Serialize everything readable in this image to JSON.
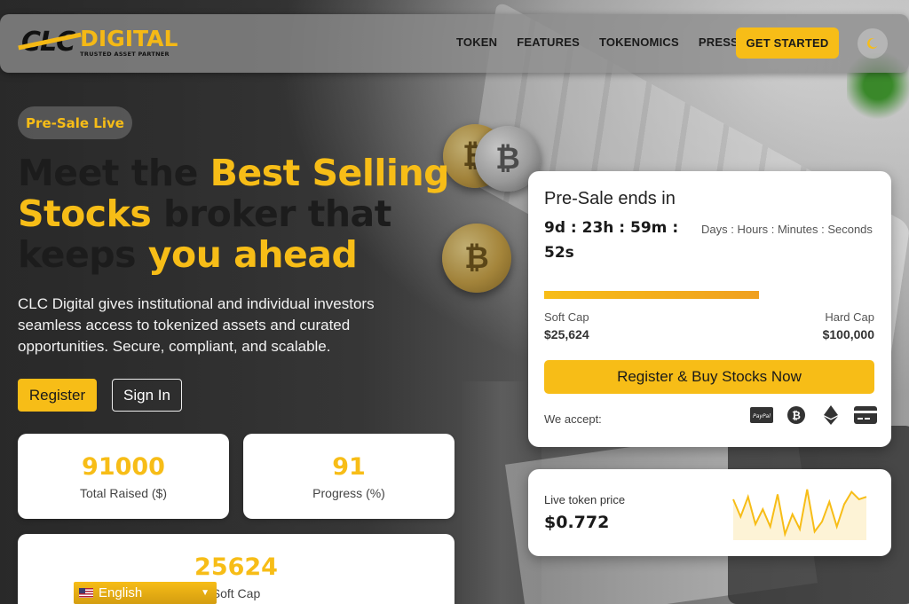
{
  "header": {
    "logo_mark": "CLC",
    "logo_title": "DIGITAL",
    "logo_subtitle": "TRUSTED ASSET PARTNER",
    "nav": [
      {
        "label": "TOKEN"
      },
      {
        "label": "FEATURES"
      },
      {
        "label": "TOKENOMICS"
      },
      {
        "label": "PRESS"
      }
    ],
    "cta_label": "GET STARTED",
    "theme_icon": "moon-icon"
  },
  "hero": {
    "badge": "Pre-Sale Live",
    "headline": {
      "p1": "Meet the ",
      "h1": "Best Selling Stocks",
      "p2": " broker that keeps ",
      "h2": "you ahead"
    },
    "lead": "CLC Digital gives institutional and individual investors seamless access to tokenized assets and curated opportunities. Secure, compliant, and scalable.",
    "register_label": "Register",
    "signin_label": "Sign In"
  },
  "stats": [
    {
      "value": "91000",
      "label": "Total Raised ($)"
    },
    {
      "value": "91",
      "label": "Progress (%)"
    },
    {
      "value": "25624",
      "label": "Soft Cap"
    }
  ],
  "language": {
    "selected": "English"
  },
  "presale": {
    "title": "Pre-Sale ends in",
    "countdown": "9d : 23h : 59m : 52s",
    "units": "Days : Hours : Minutes : Seconds",
    "progress_fraction": 0.65,
    "soft_cap_label": "Soft Cap",
    "soft_cap_value": "$25,624",
    "hard_cap_label": "Hard Cap",
    "hard_cap_value": "$100,000",
    "buy_label": "Register & Buy Stocks Now",
    "accept_label": "We accept:",
    "payment_icons": [
      "paypal-icon",
      "bitcoin-icon",
      "ethereum-icon",
      "credit-card-icon"
    ],
    "paypal_text": "PayPal"
  },
  "live_price": {
    "label": "Live token price",
    "value": "$0.772",
    "sparkline": [
      0.25,
      0.6,
      0.2,
      0.75,
      0.45,
      0.8,
      0.15,
      0.95,
      0.55,
      0.85,
      0.05,
      0.9,
      0.7,
      0.3,
      0.8,
      0.35,
      0.1,
      0.25,
      0.2
    ]
  },
  "colors": {
    "accent": "#f7bd17",
    "dark": "#1a1a1a"
  }
}
